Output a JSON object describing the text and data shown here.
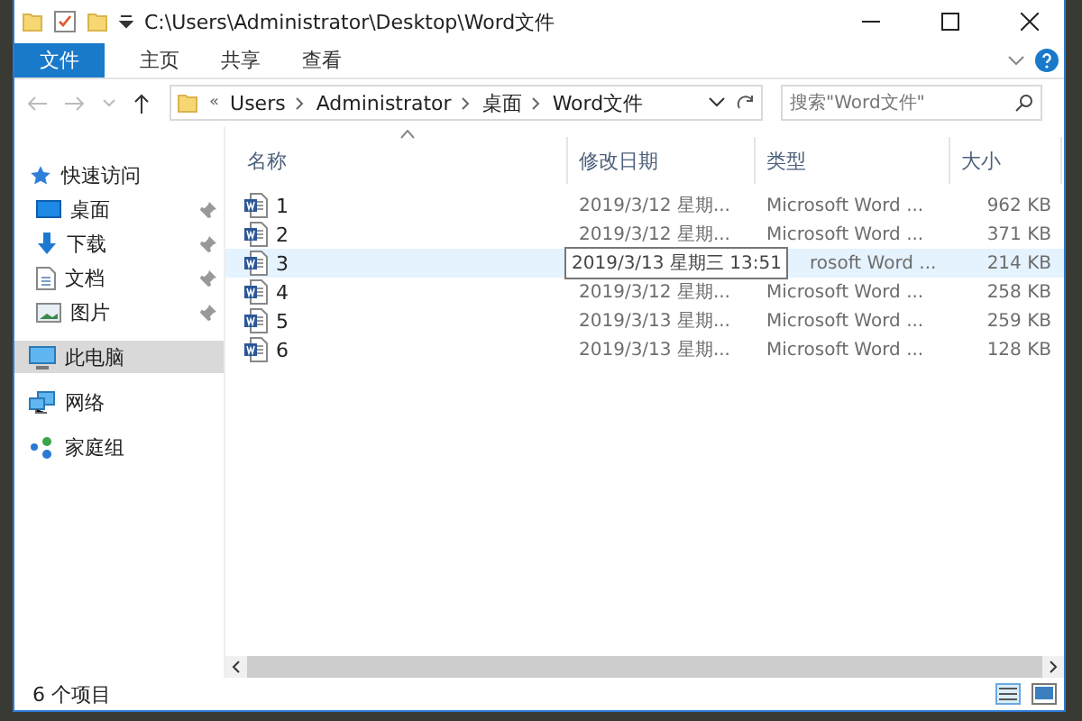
{
  "window": {
    "title": "C:\\Users\\Administrator\\Desktop\\Word文件"
  },
  "ribbon_tabs": [
    {
      "label": "文件",
      "kind": "file"
    },
    {
      "label": "主页",
      "kind": "tab"
    },
    {
      "label": "共享",
      "kind": "tab"
    },
    {
      "label": "查看",
      "kind": "tab"
    }
  ],
  "address_bar": {
    "overflow": "«",
    "crumbs": [
      "Users",
      "Administrator",
      "桌面",
      "Word文件"
    ]
  },
  "search": {
    "placeholder": "搜索\"Word文件\""
  },
  "nav": [
    {
      "label": "快速访问",
      "kind": "star",
      "selected": false,
      "children": [
        {
          "label": "桌面",
          "kind": "desktop",
          "pinned": true,
          "selected": false
        },
        {
          "label": "下载",
          "kind": "download",
          "pinned": true,
          "selected": false
        },
        {
          "label": "文档",
          "kind": "document",
          "pinned": true,
          "selected": false
        },
        {
          "label": "图片",
          "kind": "picture",
          "pinned": true,
          "selected": false
        }
      ]
    },
    {
      "label": "此电脑",
      "kind": "computer",
      "selected": true
    },
    {
      "label": "网络",
      "kind": "network",
      "selected": false
    },
    {
      "label": "家庭组",
      "kind": "homegroup",
      "selected": false
    }
  ],
  "table": {
    "columns": [
      "名称",
      "修改日期",
      "类型",
      "大小"
    ],
    "rows": [
      {
        "name": "1",
        "date": "2019/3/12 星期...",
        "type": "Microsoft Word ...",
        "size": "962 KB",
        "selected": false
      },
      {
        "name": "2",
        "date": "2019/3/12 星期...",
        "type": "Microsoft Word ...",
        "size": "371 KB",
        "selected": false
      },
      {
        "name": "3",
        "date": "",
        "type": "rosoft Word ...",
        "size": "214 KB",
        "selected": true
      },
      {
        "name": "4",
        "date": "2019/3/12 星期...",
        "type": "Microsoft Word ...",
        "size": "258 KB",
        "selected": false
      },
      {
        "name": "5",
        "date": "2019/3/13 星期...",
        "type": "Microsoft Word ...",
        "size": "259 KB",
        "selected": false
      },
      {
        "name": "6",
        "date": "2019/3/13 星期...",
        "type": "Microsoft Word ...",
        "size": "128 KB",
        "selected": false
      }
    ]
  },
  "tooltip": {
    "text": "2019/3/13 星期三 13:51"
  },
  "status_bar": {
    "count": "6 个项目"
  }
}
